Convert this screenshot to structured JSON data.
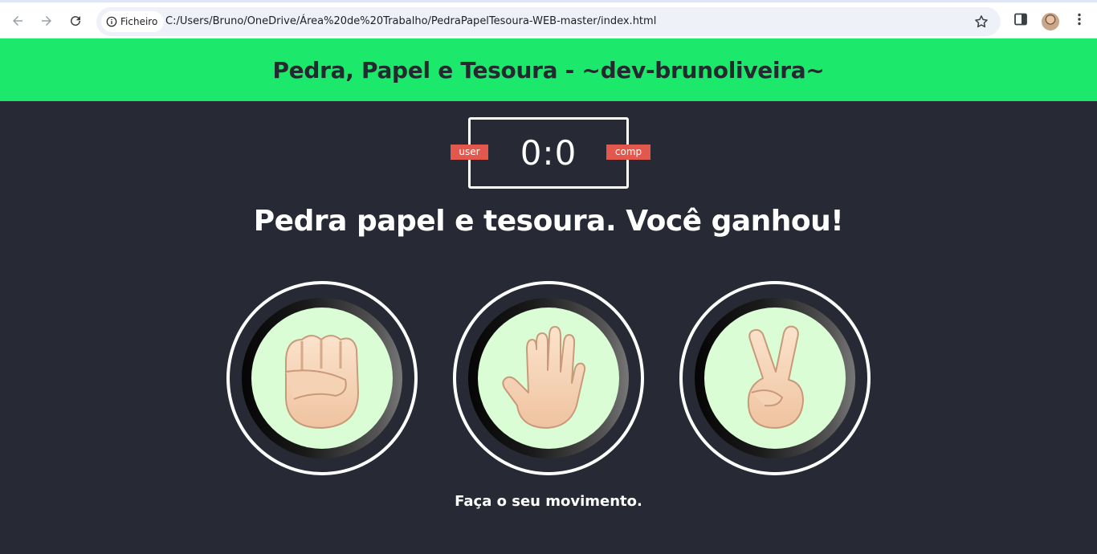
{
  "browser": {
    "site_chip_label": "Ficheiro",
    "url": "C:/Users/Bruno/OneDrive/Área%20de%20Trabalho/PedraPapelTesoura-WEB-master/index.html"
  },
  "header": {
    "title": "Pedra, Papel e Tesoura - ~dev-brunoliveira~"
  },
  "scoreboard": {
    "score": "0:0",
    "user_label": "user",
    "comp_label": "comp"
  },
  "result": {
    "text": "Pedra papel e tesoura. Você ganhou!"
  },
  "choices": [
    {
      "id": "rock",
      "icon": "fist-emoji-icon"
    },
    {
      "id": "paper",
      "icon": "raised-hand-emoji-icon"
    },
    {
      "id": "scissors",
      "icon": "victory-hand-emoji-icon"
    }
  ],
  "message": {
    "text": "Faça o seu movimento."
  },
  "colors": {
    "header_bg": "#1ce86c",
    "page_bg": "#272a35",
    "badge_bg": "#e2584d",
    "disc_bg": "#dbfdd6"
  }
}
